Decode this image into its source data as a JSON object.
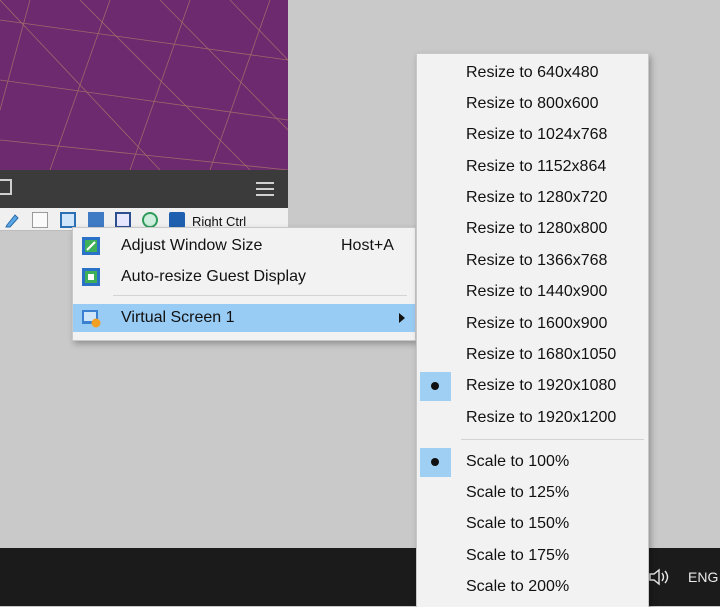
{
  "statusbar": {
    "host_key": "Right Ctrl"
  },
  "view_menu": {
    "items": [
      {
        "label": "Adjust Window Size",
        "shortcut": "Host+A"
      },
      {
        "label": "Auto-resize Guest Display",
        "shortcut": ""
      },
      {
        "label": "Virtual Screen 1",
        "shortcut": ""
      }
    ]
  },
  "screen_menu": {
    "resize_items": [
      {
        "label": "Resize to 640x480"
      },
      {
        "label": "Resize to 800x600"
      },
      {
        "label": "Resize to 1024x768"
      },
      {
        "label": "Resize to 1152x864"
      },
      {
        "label": "Resize to 1280x720"
      },
      {
        "label": "Resize to 1280x800"
      },
      {
        "label": "Resize to 1366x768"
      },
      {
        "label": "Resize to 1440x900"
      },
      {
        "label": "Resize to 1600x900"
      },
      {
        "label": "Resize to 1680x1050"
      },
      {
        "label": "Resize to 1920x1080",
        "selected": true
      },
      {
        "label": "Resize to 1920x1200"
      }
    ],
    "scale_items": [
      {
        "label": "Scale to 100%",
        "selected": true
      },
      {
        "label": "Scale to 125%"
      },
      {
        "label": "Scale to 150%"
      },
      {
        "label": "Scale to 175%"
      },
      {
        "label": "Scale to 200%"
      }
    ]
  },
  "taskbar": {
    "language": "ENG"
  },
  "colors": {
    "highlight": "#99ccf5",
    "guest_background": "#6e2a6e",
    "taskbar": "#1b1b1b"
  }
}
